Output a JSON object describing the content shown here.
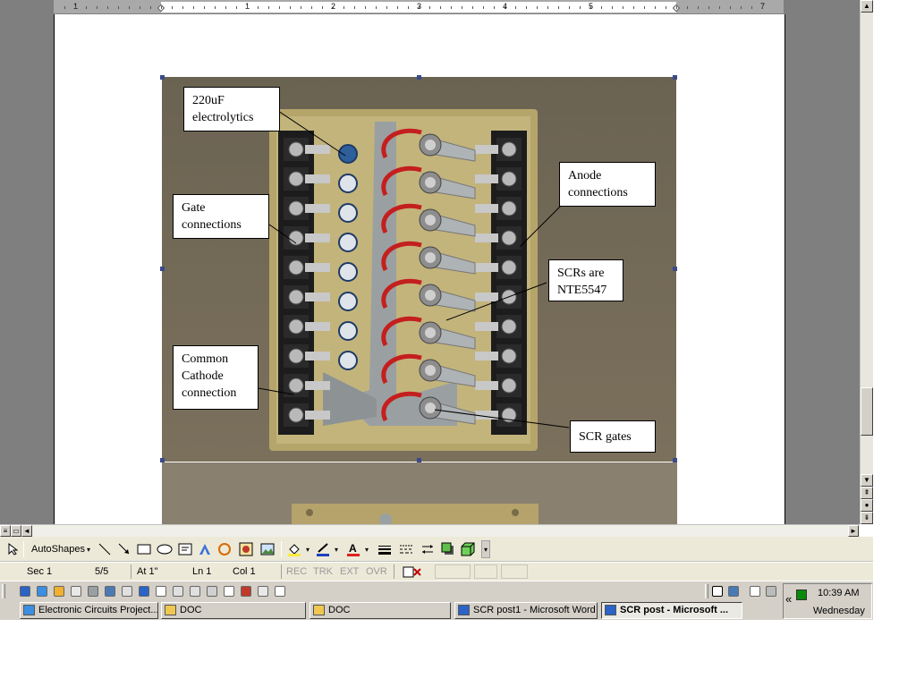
{
  "ruler": {
    "numbers": [
      "1",
      "1",
      "2",
      "3",
      "4",
      "5",
      "7"
    ]
  },
  "callouts": {
    "capacitors": "220uF\nelectrolytics",
    "gate": "Gate\nconnections",
    "cathode": "Common\nCathode\nconnection",
    "anode": "Anode\nconnections",
    "scrs": "SCRs are\nNTE5547",
    "scr_gates": "SCR gates"
  },
  "drawing_toolbar": {
    "autoshapes_label": "AutoShapes",
    "autoshapes_arrow": "▾"
  },
  "status_bar": {
    "section": "Sec 1",
    "page": "5/5",
    "at": "At 1\"",
    "line": "Ln 1",
    "col": "Col 1",
    "rec": "REC",
    "trk": "TRK",
    "ext": "EXT",
    "ovr": "OVR"
  },
  "taskbar": {
    "tasks": [
      {
        "label": "Electronic Circuits Project...",
        "icon": "ie-icon",
        "active": false
      },
      {
        "label": "DOC",
        "icon": "folder-icon",
        "active": false
      },
      {
        "label": "DOC",
        "icon": "folder-icon",
        "active": false
      },
      {
        "label": "SCR post1 - Microsoft Word",
        "icon": "word-icon",
        "active": false
      },
      {
        "label": "SCR post - Microsoft ...",
        "icon": "word-icon",
        "active": true
      }
    ],
    "tray_expand": "«",
    "clock_time": "10:39 AM",
    "clock_day": "Wednesday"
  },
  "colors": {
    "app_background": "#7f7f7f",
    "toolbar": "#ece9d8",
    "taskbar": "#d4d0c8",
    "page": "#ffffff"
  }
}
